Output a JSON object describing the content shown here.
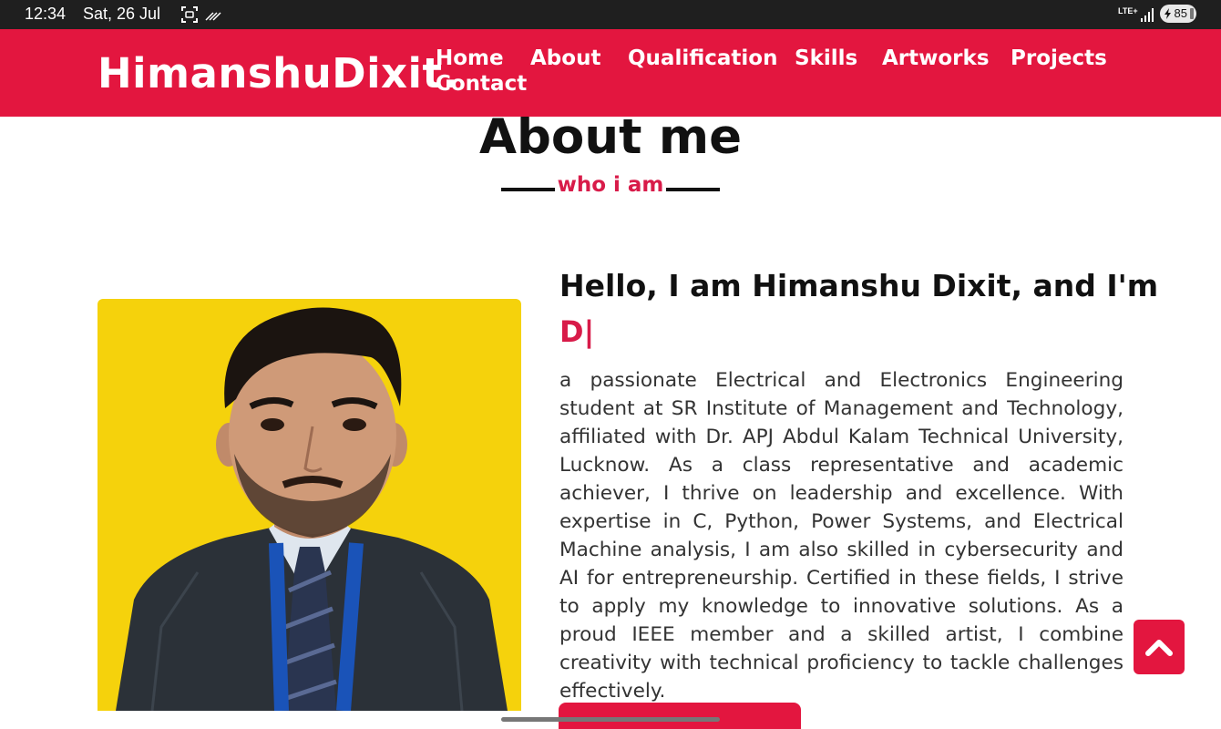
{
  "status_bar": {
    "time": "12:34",
    "date": "Sat, 26 Jul",
    "battery": "85",
    "network": "LTE+"
  },
  "header": {
    "brand": "HimanshuDixit.",
    "nav": [
      "Home",
      "About",
      "Qualification",
      "Skills",
      "Artworks",
      "Projects",
      "Contact"
    ],
    "background": "#e3163f"
  },
  "about": {
    "title": "About me",
    "subtitle": "who i am",
    "hello": "Hello, I am Himanshu Dixit, and I'm",
    "typed": "D|",
    "bio": "a passionate Electrical and Electronics Engineering student at SR Institute of Management and Technology, affiliated with Dr. APJ Abdul Kalam Technical University, Lucknow. As a class representative and academic achiever, I thrive on leadership and excellence. With expertise in C, Python, Power Systems, and Electrical Machine analysis, I am also skilled in cybersecurity and AI for entrepreneurship. Certified in these fields, I strive to apply my knowledge to innovative solutions. As a proud IEEE member and a skilled artist, I combine creativity with technical proficiency to tackle challenges effectively.",
    "photo_background": "#f5d20c",
    "accent": "#d81b49"
  },
  "icons": {
    "scroll_top": "chevron-up-icon"
  }
}
